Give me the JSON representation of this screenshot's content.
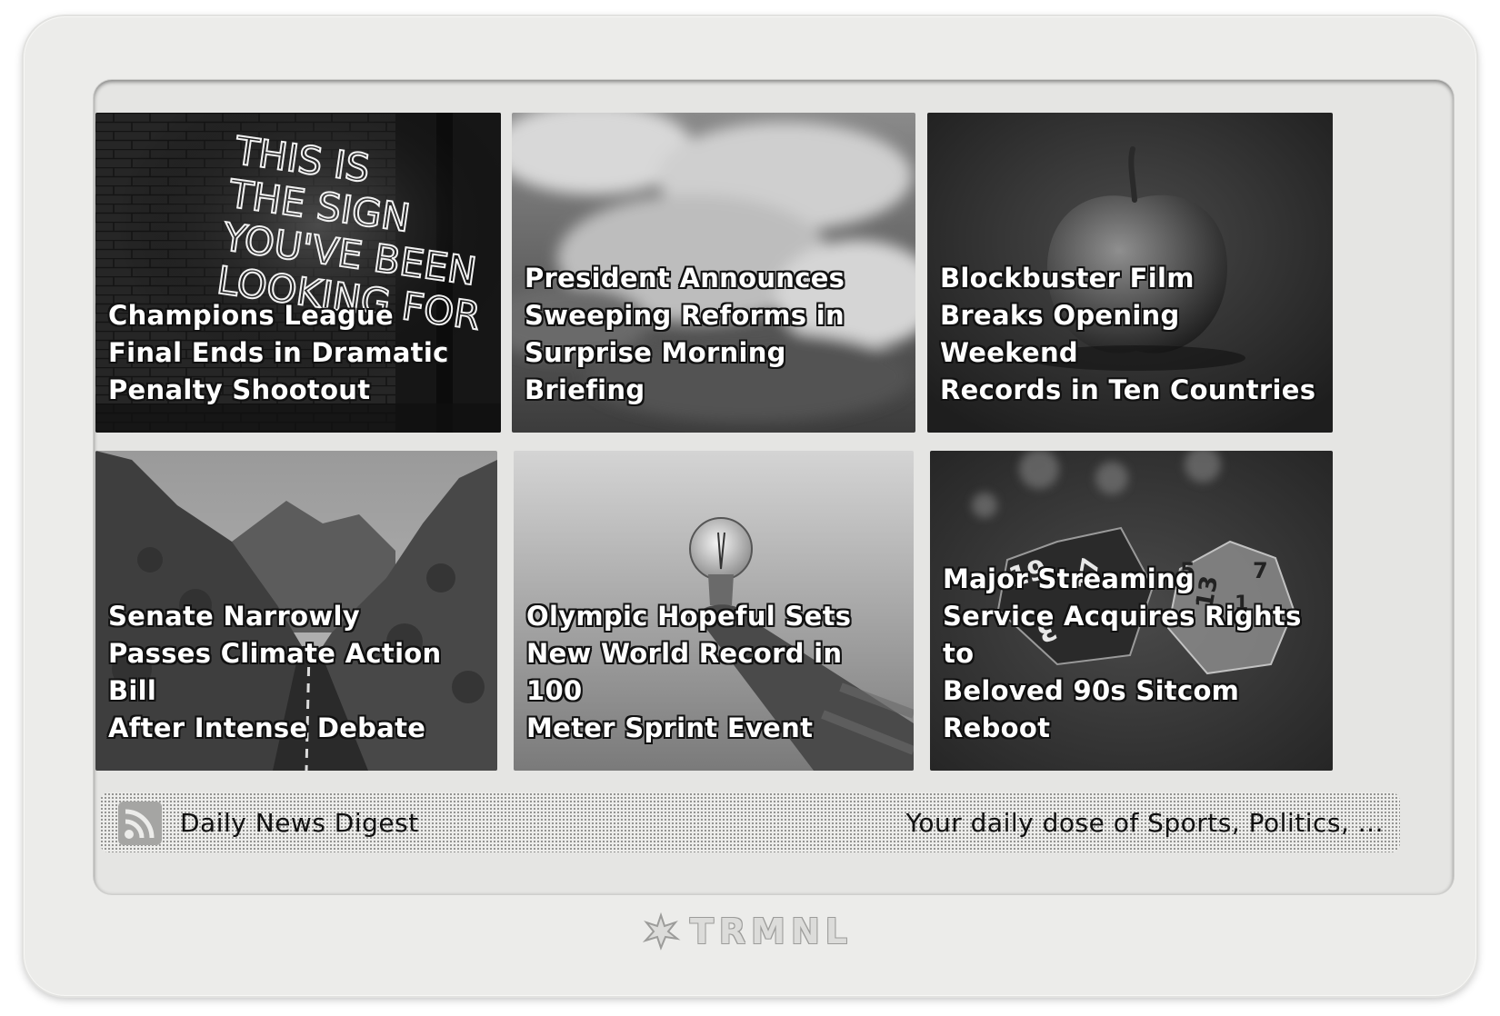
{
  "tiles": [
    {
      "headline": "Champions League\nFinal Ends in Dramatic\nPenalty Shootout",
      "image": "neon-sign-brick-wall",
      "neon_text": [
        "THIS IS",
        "THE SIGN",
        "YOU'VE BEEN",
        "LOOKING FOR"
      ]
    },
    {
      "headline": "President Announces\nSweeping Reforms in\nSurprise Morning Briefing",
      "image": "cloudy-sky"
    },
    {
      "headline": "Blockbuster Film\nBreaks Opening Weekend\nRecords in Ten Countries",
      "image": "apple"
    },
    {
      "headline": "Senate Narrowly\nPasses Climate Action Bill\nAfter Intense Debate",
      "image": "canyon-road"
    },
    {
      "headline": "Olympic Hopeful Sets\nNew World Record in 100\nMeter Sprint Event",
      "image": "hand-holding-lightbulb"
    },
    {
      "headline": "Major Streaming\nService Acquires Rights to\nBeloved 90s Sitcom Reboot",
      "image": "dice",
      "dice_numbers": [
        "19",
        "3",
        "17",
        "5",
        "13",
        "7",
        "1"
      ]
    }
  ],
  "footer": {
    "icon": "rss-icon",
    "title": "Daily News Digest",
    "description": "Your daily dose of Sports, Politics, ..."
  },
  "brand": {
    "name": "TRMNL",
    "icon": "trmnl-logo-icon"
  }
}
